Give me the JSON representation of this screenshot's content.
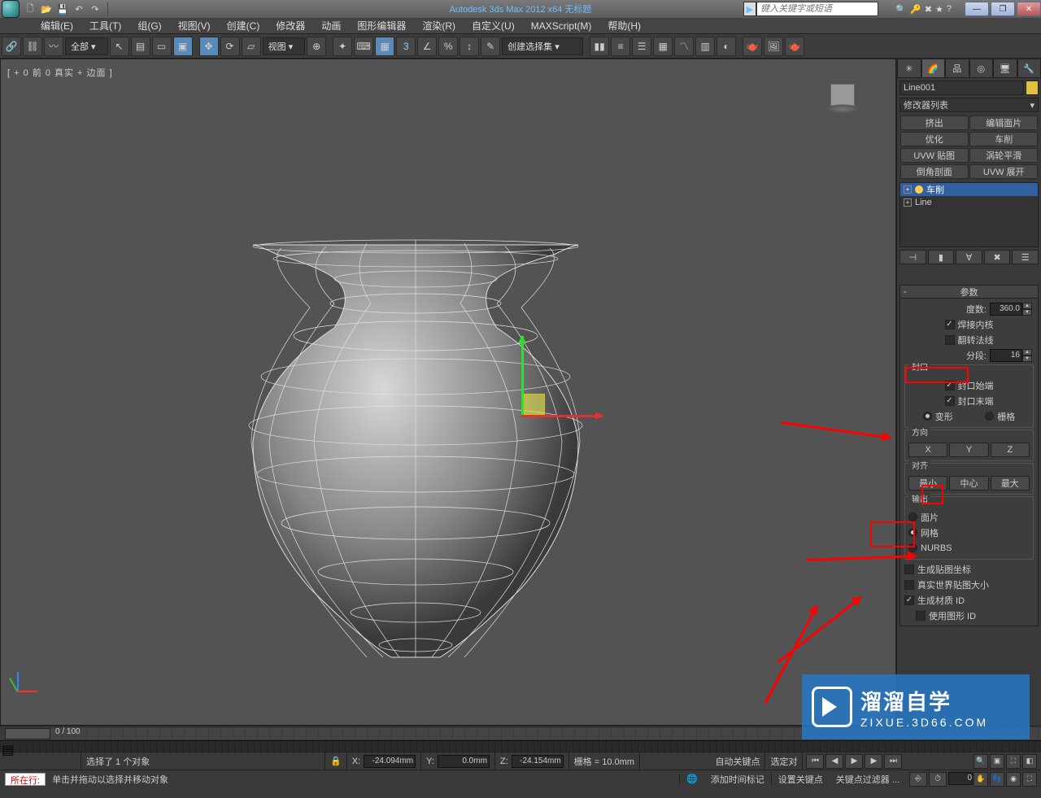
{
  "title": "Autodesk 3ds Max 2012 x64   无标题",
  "search_placeholder": "键入关键字或短语",
  "menus": [
    "编辑(E)",
    "工具(T)",
    "组(G)",
    "视图(V)",
    "创建(C)",
    "修改器",
    "动画",
    "图形编辑器",
    "渲染(R)",
    "自定义(U)",
    "MAXScript(M)",
    "帮助(H)"
  ],
  "selection_filter": "全部",
  "ref_combo": "视图",
  "named_sel_combo": "创建选择集",
  "viewport_label": "[ + 0 前 0 真实 + 边面 ]",
  "selected_object": "Line001",
  "modifier_list_label": "修改器列表",
  "mod_buttons": [
    "挤出",
    "编辑面片",
    "优化",
    "车削",
    "UVW 贴图",
    "涡轮平滑",
    "倒角剖面",
    "UVW 展开"
  ],
  "stack": [
    {
      "label": "车削",
      "selected": true,
      "bulb": true
    },
    {
      "label": "Line",
      "selected": false,
      "bulb": false
    }
  ],
  "rollout_title": "参数",
  "params": {
    "degrees_label": "度数:",
    "degrees_value": "360.0",
    "weld_core": "焊接内核",
    "flip_normals": "翻转法线",
    "segments_label": "分段:",
    "segments_value": "16",
    "cap_group": "封口",
    "cap_start": "封口始端",
    "cap_end": "封口末端",
    "morph": "变形",
    "grid": "栅格",
    "dir_group": "方向",
    "align_group": "对齐",
    "min": "最小",
    "center": "中心",
    "max": "最大",
    "output_group": "输出",
    "patch": "面片",
    "mesh": "网格",
    "nurbs": "NURBS",
    "gen_map": "生成贴图坐标",
    "real_world": "真实世界贴图大小",
    "gen_mat": "生成材质 ID",
    "use_shape": "使用图形 ID"
  },
  "timeline_label": "0 / 100",
  "status1": {
    "selected": "选择了 1 个对象",
    "x_label": "X:",
    "x": "-24.094mm",
    "y_label": "Y:",
    "y": "0.0mm",
    "z_label": "Z:",
    "z": "-24.154mm",
    "grid": "栅格 = 10.0mm",
    "autokey": "自动关键点",
    "selkey": "选定对"
  },
  "status2": {
    "hint": "单击并拖动以选择并移动对象",
    "addtime": "添加时间标记",
    "setkey": "设置关键点",
    "keyfilter": "关键点过滤器 ..."
  },
  "macro_label": "所在行:",
  "watermark": {
    "big": "溜溜自学",
    "small": "ZIXUE.3D66.COM"
  }
}
